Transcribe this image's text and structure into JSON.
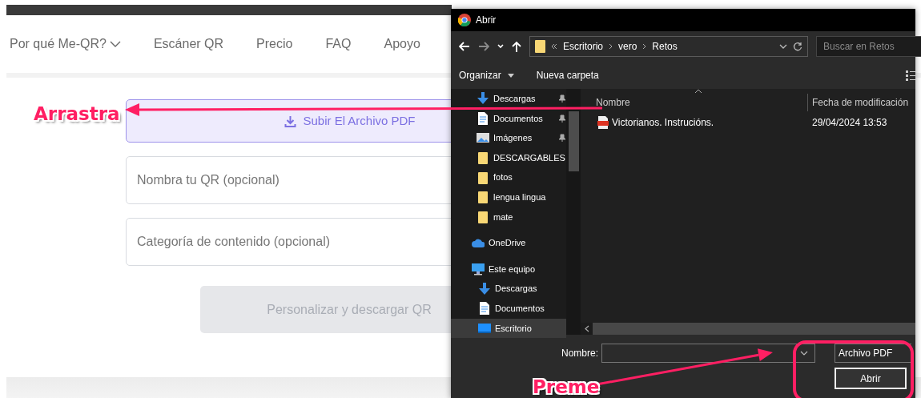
{
  "website": {
    "nav": [
      {
        "label": "Por qué Me-QR?",
        "dropdown": true
      },
      {
        "label": "Escáner QR",
        "dropdown": false
      },
      {
        "label": "Precio",
        "dropdown": false
      },
      {
        "label": "FAQ",
        "dropdown": false
      },
      {
        "label": "Apoyo",
        "dropdown": false
      }
    ],
    "upload_button": "Subir El Archivo PDF",
    "fields": [
      {
        "placeholder": "Nombra tu QR (opcional)"
      },
      {
        "placeholder": "Categoría de contenido (opcional)"
      }
    ],
    "submit_button": {
      "label": "Personalizar y descargar QR",
      "disabled": true
    }
  },
  "dialog": {
    "window": {
      "title": "Abrir"
    },
    "path": [
      "Escritorio",
      "vero",
      "Retos"
    ],
    "search": {
      "placeholder": "Buscar en Retos"
    },
    "toolbar": [
      {
        "label": "Organizar",
        "dropdown": true
      },
      {
        "label": "Nueva carpeta",
        "dropdown": false
      }
    ],
    "sidebar": {
      "quick_access": [
        {
          "label": "Descargas",
          "kind": "download",
          "pinned": true,
          "selected": false
        },
        {
          "label": "Documentos",
          "kind": "document",
          "pinned": true,
          "selected": false
        },
        {
          "label": "Imágenes",
          "kind": "image",
          "pinned": true,
          "selected": false
        },
        {
          "label": "DESCARGABLES",
          "kind": "folder",
          "pinned": false,
          "selected": false
        },
        {
          "label": "fotos",
          "kind": "folder",
          "pinned": false,
          "selected": false
        },
        {
          "label": "lengua lingua",
          "kind": "folder",
          "pinned": false,
          "selected": false
        },
        {
          "label": "mate",
          "kind": "folder",
          "pinned": false,
          "selected": false
        }
      ],
      "locations": [
        {
          "label": "OneDrive",
          "kind": "cloud",
          "selected": false
        },
        {
          "label": "Este equipo",
          "kind": "computer",
          "selected": false,
          "children": [
            {
              "label": "Descargas",
              "kind": "download",
              "selected": false
            },
            {
              "label": "Documentos",
              "kind": "document",
              "selected": false
            },
            {
              "label": "Escritorio",
              "kind": "desktop",
              "selected": true
            }
          ]
        }
      ]
    },
    "table": {
      "columns": [
        "Nombre",
        "Fecha de modificación"
      ],
      "rows": [
        {
          "name": "Victorianos. Instrucións.",
          "modified": "29/04/2024 13:53",
          "selected": false
        }
      ]
    },
    "footer": {
      "filename_label": "Nombre:",
      "filter": "Archivo PDF",
      "open_button": "Abrir"
    }
  },
  "annotations": [
    {
      "kind": "drag",
      "text": "Arrastra"
    },
    {
      "kind": "click",
      "text": "Preme"
    }
  ]
}
